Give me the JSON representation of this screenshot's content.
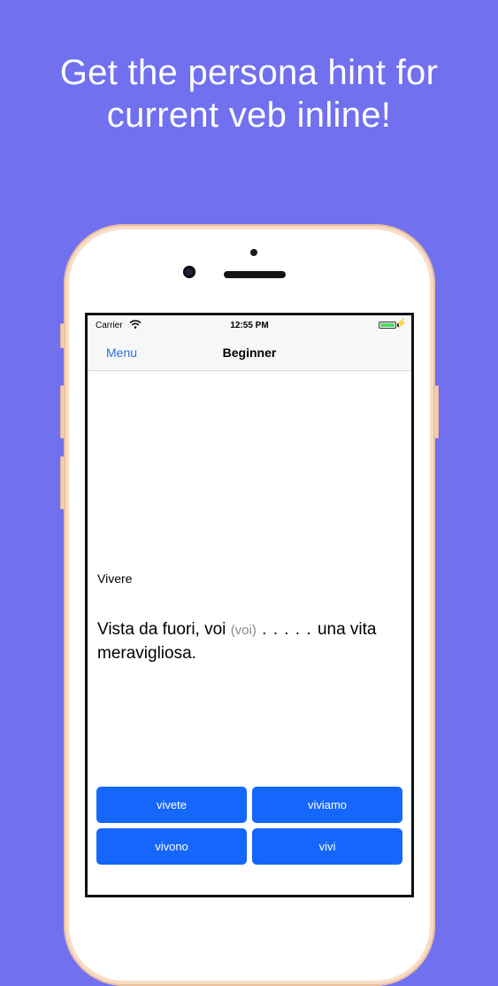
{
  "headline": {
    "line1": "Get the persona hint for",
    "line2": "current veb inline!"
  },
  "status_bar": {
    "carrier": "Carrier",
    "time": "12:55 PM",
    "charging_symbol": "⚡"
  },
  "nav": {
    "menu_label": "Menu",
    "title": "Beginner"
  },
  "exercise": {
    "verb": "Vivere",
    "sentence_before": "Vista da fuori, voi ",
    "persona_hint": "(voi)",
    "blank": " . . . . .  ",
    "sentence_after": "una vita meravigliosa."
  },
  "answers": [
    "vivete",
    "viviamo",
    "vivono",
    "vivi"
  ],
  "colors": {
    "background": "#7170ef",
    "button": "#1567fb",
    "nav_link": "#2f6fd6",
    "battery": "#4cd964"
  },
  "icons": [
    "wifi-icon",
    "battery-icon",
    "charging-bolt-icon"
  ]
}
